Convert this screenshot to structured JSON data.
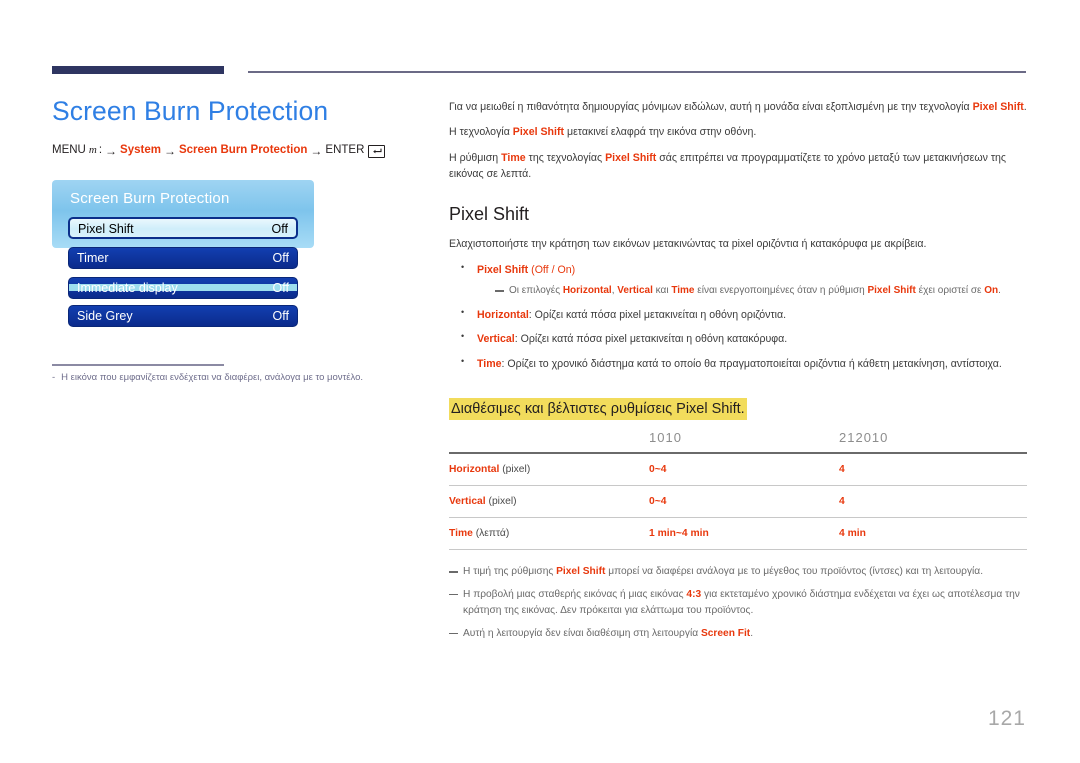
{
  "document": {
    "page_number": "121"
  },
  "left": {
    "title": "Screen Burn Protection",
    "breadcrumb": {
      "menu_label": "MENU",
      "menu_glyph": "m",
      "colon": ":",
      "arrow": "→",
      "item1": "System",
      "item2": "Screen Burn Protection",
      "enter_label": "ENTER",
      "enter_icon": "enter-key-icon"
    },
    "osd": {
      "title": "Screen Burn Protection",
      "rows": [
        {
          "label": "Pixel Shift",
          "value": "Off",
          "state": "selected"
        },
        {
          "label": "Timer",
          "value": "Off",
          "state": "normal"
        },
        {
          "label": "Immediate display",
          "value": "Off",
          "state": "glitch"
        },
        {
          "label": "Side Grey",
          "value": "Off",
          "state": "normal"
        }
      ]
    },
    "footnote": {
      "dash": "-",
      "text": "Η εικόνα που εμφανίζεται ενδέχεται να διαφέρει, ανάλογα με το μοντέλο."
    }
  },
  "right": {
    "intro": {
      "p1_a": "Για να μειωθεί η πιθανότητα δημιουργίας μόνιμων ειδώλων, αυτή η μονάδα είναι εξοπλισμένη με την τεχνολογία ",
      "p1_b": "Pixel Shift",
      "p1_c": ".",
      "p2_a": "Η τεχνολογία ",
      "p2_b": "Pixel Shift",
      "p2_c": " μετακινεί ελαφρά την εικόνα στην οθόνη.",
      "p3_a": "Η ρύθμιση ",
      "p3_b": "Time",
      "p3_c": " της τεχνολογίας ",
      "p3_d": "Pixel Shift",
      "p3_e": " σάς επιτρέπει να προγραμματίζετε το χρόνο μεταξύ των μετακινήσεων της εικόνας σε λεπτά."
    },
    "section_title": "Pixel Shift",
    "section_intro": "Ελαχιστοποιήστε την κράτηση των εικόνων μετακινώντας τα pixel οριζόντια ή κατακόρυφα με ακρίβεια.",
    "bullets": [
      {
        "term": "Pixel Shift",
        "rest": " (Off / On)",
        "subnote": {
          "a": "Οι επιλογές ",
          "b": "Horizontal",
          "c": ", ",
          "d": "Vertical",
          "e": " και ",
          "f": "Time",
          "g": " είναι ενεργοποιημένες όταν η ρύθμιση ",
          "h": "Pixel Shift",
          "i": " έχει οριστεί σε ",
          "j": "On",
          "k": "."
        }
      },
      {
        "term": "Horizontal",
        "rest": ": Ορίζει κατά πόσα pixel μετακινείται η οθόνη οριζόντια."
      },
      {
        "term": "Vertical",
        "rest": ": Ορίζει κατά πόσα pixel μετακινείται η οθόνη κατακόρυφα."
      },
      {
        "term": "Time",
        "rest": ": Ορίζει το χρονικό διάστημα κατά το οποίο θα πραγματοποιείται οριζόντια ή κάθετη μετακίνηση, αντίστοιχα."
      }
    ],
    "highlighted_heading": "Διαθέσιμες και βέλτιστες ρυθμίσεις Pixel Shift.",
    "table": {
      "headers": [
        "",
        "1010",
        "212010"
      ],
      "rows": [
        {
          "label": "Horizontal",
          "unit": "(pixel)",
          "col2": "0~4",
          "col3": "4"
        },
        {
          "label": "Vertical",
          "unit": "(pixel)",
          "col2": "0~4",
          "col3": "4"
        },
        {
          "label": "Time",
          "unit": "(λεπτά)",
          "col2": "1 min~4 min",
          "col3": "4 min"
        }
      ]
    },
    "bottom_notes": [
      {
        "a": "Η τιμή της ρύθμισης ",
        "b": "Pixel Shift",
        "c": " μπορεί να διαφέρει ανάλογα με το μέγεθος του προϊόντος (ίντσες) και τη λειτουργία.",
        "d": "",
        "e": ""
      },
      {
        "a": "Η προβολή μιας σταθερής εικόνας ή μιας εικόνας ",
        "b": "4:3",
        "c": " για εκτεταμένο χρονικό διάστημα ενδέχεται να έχει ως αποτέλεσμα την κράτηση της εικόνας. Δεν πρόκειται για ελάττωμα του προϊόντος.",
        "d": "",
        "e": ""
      },
      {
        "a": "Αυτή η λειτουργία δεν είναι διαθέσιμη στη λειτουργία ",
        "b": "Screen Fit",
        "c": ".",
        "d": "",
        "e": ""
      }
    ]
  }
}
